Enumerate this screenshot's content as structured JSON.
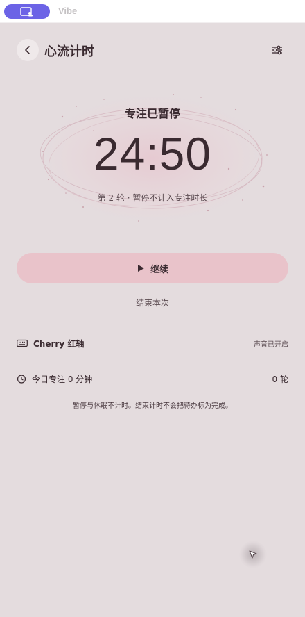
{
  "window": {
    "app_name": "Vibe"
  },
  "header": {
    "title": "心流计时"
  },
  "timer": {
    "status": "专注已暂停",
    "value": "24:50",
    "round_info": "第 2 轮 · 暂停不计入专注时长"
  },
  "actions": {
    "resume_label": "继续",
    "end_label": "结束本次"
  },
  "sound": {
    "name": "Cherry 红轴",
    "status": "声音已开启"
  },
  "stats": {
    "label": "今日专注 0 分钟",
    "rounds": "0 轮"
  },
  "footnote": "暂停与休眠不计时。结束计时不会把待办标为完成。",
  "colors": {
    "accent_pill": "#6c63e6",
    "background": "#e4dcde",
    "resume_button": "#e9c3ca",
    "text_primary": "#3a2a30"
  },
  "icons": [
    "app-window-icon",
    "back-arrow-icon",
    "sliders-icon",
    "play-icon",
    "keyboard-icon",
    "timer-icon",
    "cursor-arrow-icon"
  ]
}
